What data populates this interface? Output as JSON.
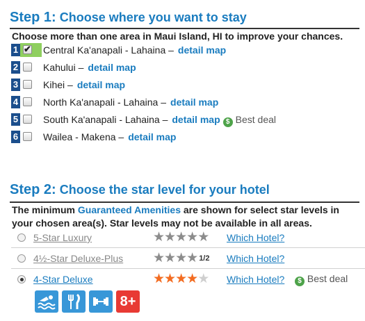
{
  "step1": {
    "title_lead": "Step 1:",
    "title_rest": "Choose where you want to stay",
    "instructions": "Choose more than one area in Maui Island, HI to improve your chances.",
    "areas": [
      {
        "num": "1",
        "name": "Central Ka'anapali - Lahaina –",
        "link": "detail map",
        "checked": true
      },
      {
        "num": "2",
        "name": "Kahului –",
        "link": "detail map",
        "checked": false
      },
      {
        "num": "3",
        "name": "Kihei –",
        "link": "detail map",
        "checked": false
      },
      {
        "num": "4",
        "name": "North Ka'anapali - Lahaina –",
        "link": "detail map",
        "checked": false
      },
      {
        "num": "5",
        "name": "South Ka'anapali - Lahaina –",
        "link": "detail map",
        "checked": false,
        "deal_icon": "$",
        "deal": "Best deal"
      },
      {
        "num": "6",
        "name": "Wailea - Makena –",
        "link": "detail map",
        "checked": false
      }
    ]
  },
  "step2": {
    "title_lead": "Step 2:",
    "title_rest": "Choose the star level for your hotel",
    "instr_pre": "The minimum",
    "instr_link": "Guaranteed Amenities",
    "instr_post": "are shown for select star levels in your chosen area(s). Star levels may not be available in all areas.",
    "levels": [
      {
        "label": "5-Star Luxury",
        "stars": 5,
        "half": "",
        "which": "Which Hotel?",
        "selected": false,
        "deal": ""
      },
      {
        "label": "4½-Star Deluxe-Plus",
        "stars": 4,
        "half": "1/2",
        "which": "Which Hotel?",
        "selected": false,
        "deal": ""
      },
      {
        "label": "4-Star Deluxe",
        "stars": 4,
        "half": "",
        "which": "Which Hotel?",
        "selected": true,
        "deal_icon": "$",
        "deal": "Best deal"
      }
    ],
    "amenities": [
      {
        "icon": "pool-icon"
      },
      {
        "icon": "restaurant-icon"
      },
      {
        "icon": "fitness-icon"
      },
      {
        "icon": "age-restriction-icon",
        "text": "8+"
      }
    ]
  },
  "colors": {
    "accent": "#1a7cbf",
    "number_box": "#1b4e8c",
    "highlight": "#8fcf5f",
    "deal": "#4ea34a",
    "star_active": "#f36c21",
    "amenity_blue": "#3897d8",
    "amenity_red": "#e83a34"
  }
}
